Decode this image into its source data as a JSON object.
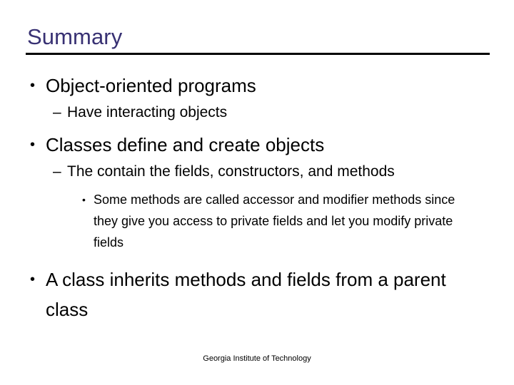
{
  "slide": {
    "title": "Summary",
    "title_color": "#383173",
    "body_color": "#000000",
    "background_color": "#ffffff",
    "rule_color": "#000000"
  },
  "bullets": [
    {
      "level": 1,
      "marker": "•",
      "marker_name": "bullet-dot",
      "text": "Object-oriented programs"
    },
    {
      "level": 2,
      "marker": "–",
      "marker_name": "bullet-dash",
      "text": "Have interacting objects"
    },
    {
      "level": 1,
      "marker": "•",
      "marker_name": "bullet-dot",
      "text": "Classes define and create objects"
    },
    {
      "level": 2,
      "marker": "–",
      "marker_name": "bullet-dash",
      "text": "The contain the fields, constructors, and methods"
    },
    {
      "level": 3,
      "marker": "•",
      "marker_name": "bullet-dot",
      "text": "Some methods are called accessor and modifier methods since they give you access to private fields and let you modify private fields"
    },
    {
      "level": 1,
      "marker": "•",
      "marker_name": "bullet-dot",
      "text": "A class inherits methods and fields from a parent class"
    }
  ],
  "footer": {
    "text": "Georgia Institute of Technology"
  }
}
